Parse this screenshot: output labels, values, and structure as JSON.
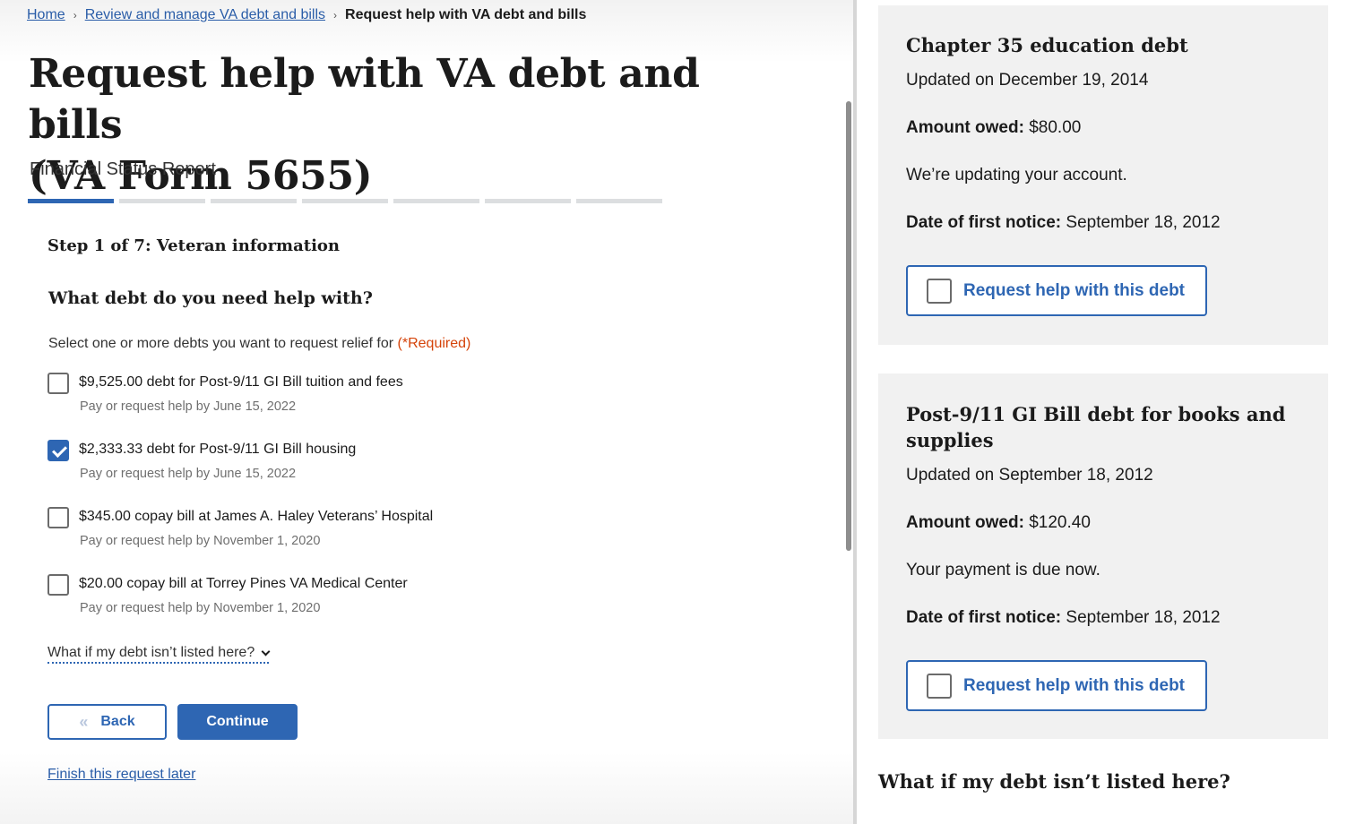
{
  "breadcrumb": {
    "home": "Home",
    "review": "Review and manage VA debt and bills",
    "current": "Request help with VA debt and bills",
    "sep": "›"
  },
  "page": {
    "title_line1": "Request help with VA debt and bills",
    "title_line2": "(VA Form 5655)",
    "subtitle": "Financial Status Report"
  },
  "progress": {
    "total_steps": 7,
    "current_step": 1
  },
  "form": {
    "step_title": "Step 1 of 7: Veteran information",
    "question": "What debt do you need help with?",
    "hint": "Select one or more debts you want to request relief for",
    "required": "(*Required)",
    "options": [
      {
        "label": "$9,525.00 debt for Post-9/11 GI Bill tuition and fees",
        "sub": "Pay or request help by June 15, 2022",
        "checked": false
      },
      {
        "label": "$2,333.33 debt for Post-9/11 GI Bill housing",
        "sub": "Pay or request help by June 15, 2022",
        "checked": true
      },
      {
        "label": "$345.00 copay bill at James A. Haley Veterans’ Hospital",
        "sub": "Pay or request help by November 1, 2020",
        "checked": false
      },
      {
        "label": "$20.00 copay bill at Torrey Pines VA Medical Center",
        "sub": "Pay or request help by November 1, 2020",
        "checked": false
      }
    ],
    "expand_link": "What if my debt isn’t listed here?",
    "back_label": "Back",
    "back_arrow": "«",
    "continue_label": "Continue",
    "finish_later": "Finish this request later"
  },
  "cards": [
    {
      "title": "Chapter 35 education debt",
      "updated": "Updated on December 19, 2014",
      "amount_label": "Amount owed:",
      "amount": "$80.00",
      "status": "We’re updating your account.",
      "notice_label": "Date of first notice:",
      "notice": "September 18, 2012",
      "button": "Request help with this debt"
    },
    {
      "title": "Post-9/11 GI Bill debt for books and supplies",
      "updated": "Updated on September 18, 2012",
      "amount_label": "Amount owed:",
      "amount": "$120.40",
      "status": "Your payment is due now.",
      "notice_label": "Date of first notice:",
      "notice": "September 18, 2012",
      "button": "Request help with this debt"
    }
  ],
  "right_heading": "What if my debt isn’t listed here?",
  "colors": {
    "primary": "#2e66b3",
    "link": "#2a5da8",
    "required": "#d54309",
    "card_bg": "#f1f1f1"
  }
}
